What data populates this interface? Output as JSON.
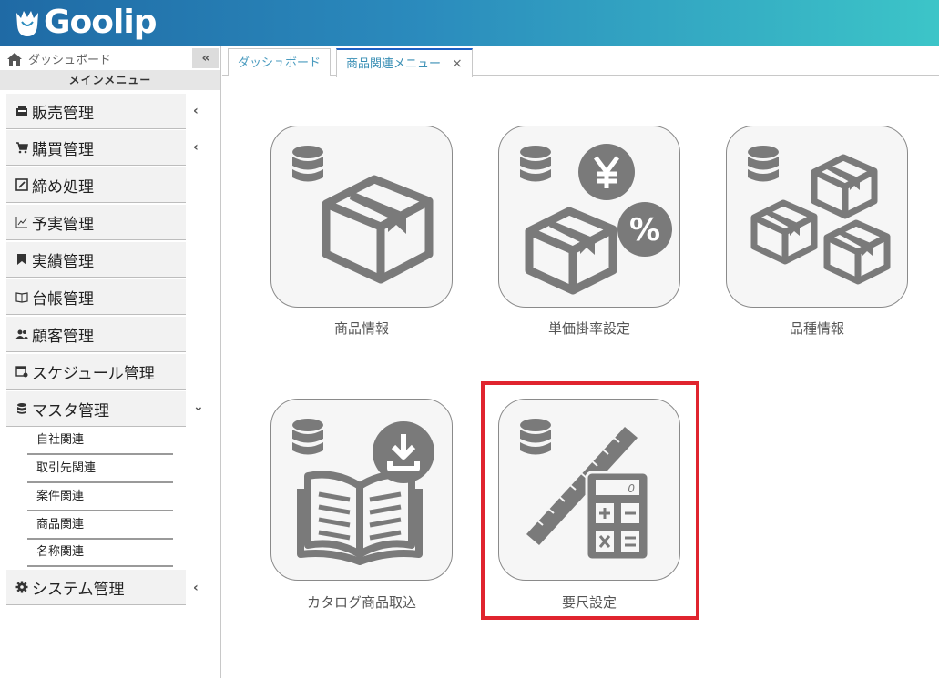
{
  "header": {
    "logo_text": "Goolip"
  },
  "sidebar": {
    "home_label": "ダッシュボード",
    "collapse_symbol": "«",
    "section_title": "メインメニュー",
    "items": [
      {
        "label": "販売管理",
        "icon": "register-icon",
        "chevron": "‹"
      },
      {
        "label": "購買管理",
        "icon": "cart-icon",
        "chevron": "‹"
      },
      {
        "label": "締め処理",
        "icon": "edit-box-icon",
        "chevron": ""
      },
      {
        "label": "予実管理",
        "icon": "line-chart-icon",
        "chevron": ""
      },
      {
        "label": "実績管理",
        "icon": "bookmark-icon",
        "chevron": ""
      },
      {
        "label": "台帳管理",
        "icon": "book-icon",
        "chevron": ""
      },
      {
        "label": "顧客管理",
        "icon": "users-icon",
        "chevron": ""
      },
      {
        "label": "スケジュール管理",
        "icon": "calendar-icon",
        "chevron": ""
      },
      {
        "label": "マスタ管理",
        "icon": "database-icon",
        "chevron": "⌄"
      },
      {
        "label": "システム管理",
        "icon": "gear-icon",
        "chevron": "‹"
      }
    ],
    "sub_items": [
      "自社関連",
      "取引先関連",
      "案件関連",
      "商品関連",
      "名称関連"
    ]
  },
  "tabs": [
    {
      "label": "ダッシュボード",
      "active": false
    },
    {
      "label": "商品関連メニュー",
      "active": true,
      "close": "×"
    }
  ],
  "tiles": [
    {
      "label": "商品情報",
      "icon": "product-box-icon"
    },
    {
      "label": "単価掛率設定",
      "icon": "price-rate-icon"
    },
    {
      "label": "品種情報",
      "icon": "multi-box-icon"
    },
    {
      "label": "カタログ商品取込",
      "icon": "catalog-import-icon"
    },
    {
      "label": "要尺設定",
      "icon": "ruler-calculator-icon",
      "highlighted": true
    }
  ],
  "calculator_display": "0",
  "colors": {
    "accent_red": "#e0242e",
    "icon_gray": "#7a7a7a",
    "header_start": "#1f6aa5",
    "header_end": "#3cc5c8"
  }
}
